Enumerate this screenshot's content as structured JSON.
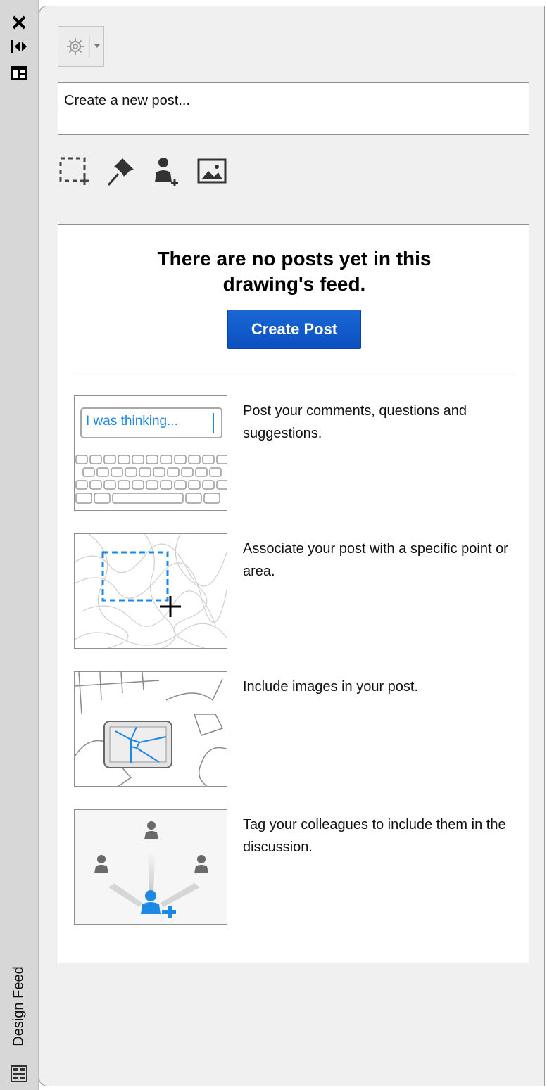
{
  "sidebar": {
    "title": "Design Feed",
    "icons": [
      "close-icon",
      "autohide-icon",
      "properties-icon",
      "palette-icon"
    ]
  },
  "toolbar": {
    "gear_icon": "gear-icon"
  },
  "composer": {
    "placeholder": "Create a new post..."
  },
  "tools": [
    "select-area-icon",
    "pin-icon",
    "tag-user-icon",
    "image-icon"
  ],
  "empty_state": {
    "headline_line1": "There are no posts yet in this",
    "headline_line2": "drawing's feed.",
    "button_label": "Create Post"
  },
  "tips": [
    {
      "text": "Post your comments, questions and suggestions.",
      "image_caption": "I was thinking..."
    },
    {
      "text": "Associate your post with a specific point or area."
    },
    {
      "text": "Include images in your post."
    },
    {
      "text": "Tag your colleagues to include them in the discussion."
    }
  ],
  "colors": {
    "accent_blue": "#1a67d6",
    "highlight_blue": "#1e88e5",
    "panel_bg": "#f0f0f0",
    "strip_bg": "#d7d7d7"
  }
}
